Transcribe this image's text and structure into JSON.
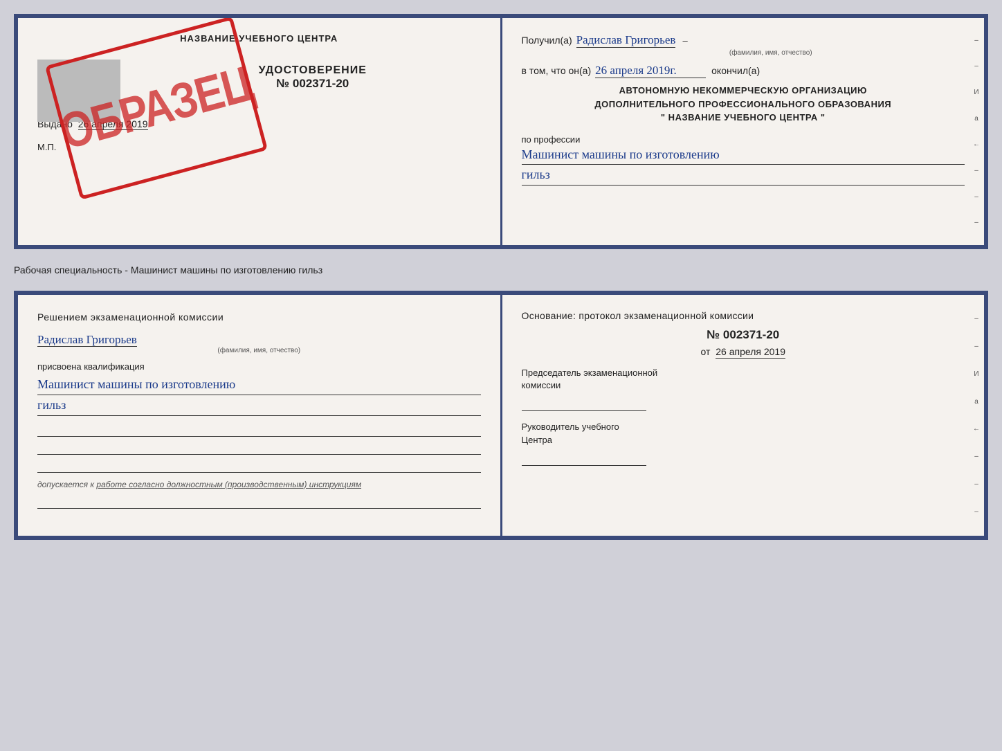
{
  "top_doc": {
    "left": {
      "title": "НАЗВАНИЕ УЧЕБНОГО ЦЕНТРА",
      "cert_label": "УДОСТОВЕРЕНИЕ",
      "cert_number": "№ 002371-20",
      "issued_label": "Выдано",
      "issued_date": "26 апреля 2019",
      "mp_label": "М.П.",
      "stamp_text": "ОБРАЗЕЦ"
    },
    "right": {
      "received_prefix": "Получил(а)",
      "name_handwritten": "Радислав Григорьев",
      "name_sublabel": "(фамилия, имя, отчество)",
      "date_prefix": "в том, что он(а)",
      "date_handwritten": "26 апреля 2019г.",
      "date_suffix": "окончил(а)",
      "org_line1": "АВТОНОМНУЮ НЕКОММЕРЧЕСКУЮ ОРГАНИЗАЦИЮ",
      "org_line2": "ДОПОЛНИТЕЛЬНОГО ПРОФЕССИОНАЛЬНОГО ОБРАЗОВАНИЯ",
      "org_line3": "\" НАЗВАНИЕ УЧЕБНОГО ЦЕНТРА \"",
      "profession_prefix": "по профессии",
      "profession_handwritten1": "Машинист машины по изготовлению",
      "profession_handwritten2": "гильз"
    }
  },
  "caption": "Рабочая специальность - Машинист машины по изготовлению гильз",
  "bottom_doc": {
    "left": {
      "commission_title": "Решением  экзаменационной  комиссии",
      "name_handwritten": "Радислав Григорьев",
      "name_sublabel": "(фамилия, имя, отчество)",
      "assigned_label": "присвоена квалификация",
      "qualification_handwritten1": "Машинист машины по изготовлению",
      "qualification_handwritten2": "гильз",
      "допускается_prefix": "допускается к",
      "допускается_underlined": "работе согласно должностным (производственным) инструкциям"
    },
    "right": {
      "osnov_title": "Основание: протокол экзаменационной комиссии",
      "protocol_number": "№ 002371-20",
      "date_prefix": "от",
      "date_value": "26 апреля 2019",
      "chairman_label1": "Председатель экзаменационной",
      "chairman_label2": "комиссии",
      "head_label1": "Руководитель учебного",
      "head_label2": "Центра"
    }
  },
  "side_marks": [
    "-",
    "-",
    "И",
    "а",
    "←",
    "-",
    "-",
    "-"
  ]
}
